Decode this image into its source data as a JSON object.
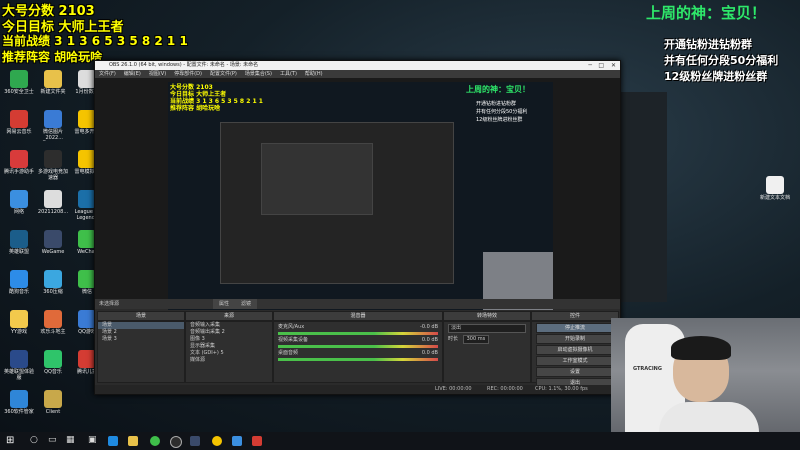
{
  "overlay": {
    "line1": "大号分数 2103",
    "line2": "今日目标 大师上王者",
    "line3": "当前战绩 3 1 3 6 5 3 5 8 2 1 1",
    "line4": "推荐阵容 胡哈玩啥"
  },
  "god_banner": "上周的神：宝贝！",
  "right_promo": {
    "line1": "开通钻粉进钻粉群",
    "line2": "并有任何分段50分福利",
    "line3": "12级粉丝牌进粉丝群"
  },
  "desktop_icons": [
    {
      "label": "360安全卫士",
      "color": "#2fa84f"
    },
    {
      "label": "新建文件夹",
      "color": "#e8c14a"
    },
    {
      "label": "1月份数据",
      "color": "#dddddd"
    },
    {
      "label": "网易云音乐",
      "color": "#d43c33"
    },
    {
      "label": "微信图片_2022...",
      "color": "#3a7bd5"
    },
    {
      "label": "雷电多开器",
      "color": "#f5c400"
    },
    {
      "label": "腾讯手游助手",
      "color": "#d83b3b"
    },
    {
      "label": "多游戏电竞加速器",
      "color": "#2d2d2d"
    },
    {
      "label": "雷电模拟器",
      "color": "#f5c400"
    },
    {
      "label": "网络",
      "color": "#3b8fe0"
    },
    {
      "label": "20211208...",
      "color": "#dddddd"
    },
    {
      "label": "League of Legends",
      "color": "#1b6fa8"
    },
    {
      "label": "英雄联盟",
      "color": "#1b5d8a"
    },
    {
      "label": "WeGame",
      "color": "#3a4a6a"
    },
    {
      "label": "WeChat",
      "color": "#3fbf4a"
    },
    {
      "label": "酷狗音乐",
      "color": "#2d8ce8"
    },
    {
      "label": "360压缩",
      "color": "#3ba7e0"
    },
    {
      "label": "微信",
      "color": "#3fbf4a"
    },
    {
      "label": "YY游戏",
      "color": "#f2c94c"
    },
    {
      "label": "欢乐斗地主",
      "color": "#e06a3a"
    },
    {
      "label": "QQ游戏",
      "color": "#3a7bd5"
    },
    {
      "label": "英雄联盟体验服",
      "color": "#2a4a8a"
    },
    {
      "label": "QQ音乐",
      "color": "#2fc46a"
    },
    {
      "label": "腾讯儿童",
      "color": "#d43c33"
    },
    {
      "label": "360软件管家",
      "color": "#2f86d8"
    },
    {
      "label": "Client",
      "color": "#c8a84a"
    }
  ],
  "right_desktop_icon": "新建文本文档",
  "obs": {
    "title": "OBS 26.1.0 (64 bit, windows) - 配置文件: 未命名 - 场景: 未命名",
    "menus": [
      "文件(F)",
      "编辑(E)",
      "视图(V)",
      "停靠部件(D)",
      "配置文件(P)",
      "场景集合(S)",
      "工具(T)",
      "帮助(H)"
    ],
    "no_source": "未选择源",
    "properties_btn": "属性",
    "filters_btn": "滤镜",
    "docks": {
      "scenes": "场景",
      "sources": "来源",
      "mixer": "混音器",
      "transitions": "转场特效",
      "controls": "控件"
    },
    "scenes": [
      "场景",
      "场景 2",
      "场景 3"
    ],
    "sources": [
      "音频输入采集",
      "音频输出采集 2",
      "图像 3",
      "显示器采集",
      "文本 (GDI+) 5",
      "媒体源"
    ],
    "mixer_tracks": [
      {
        "name": "麦克风/Aux",
        "db": "-0.0 dB"
      },
      {
        "name": "视频采集设备",
        "db": "0.0 dB"
      },
      {
        "name": "桌面音频",
        "db": "0.0 dB"
      }
    ],
    "transition": {
      "name": "淡出",
      "duration_label": "时长",
      "duration": "300 ms"
    },
    "controls": [
      "停止推流",
      "开始录制",
      "启动虚拟摄像机",
      "工作室模式",
      "设置",
      "退出"
    ],
    "status": {
      "live": "LIVE: 00:00:00",
      "rec": "REC: 00:00:00",
      "cpu": "CPU: 1.1%, 30.00 fps"
    }
  },
  "webcam_brand": "GTRACING"
}
